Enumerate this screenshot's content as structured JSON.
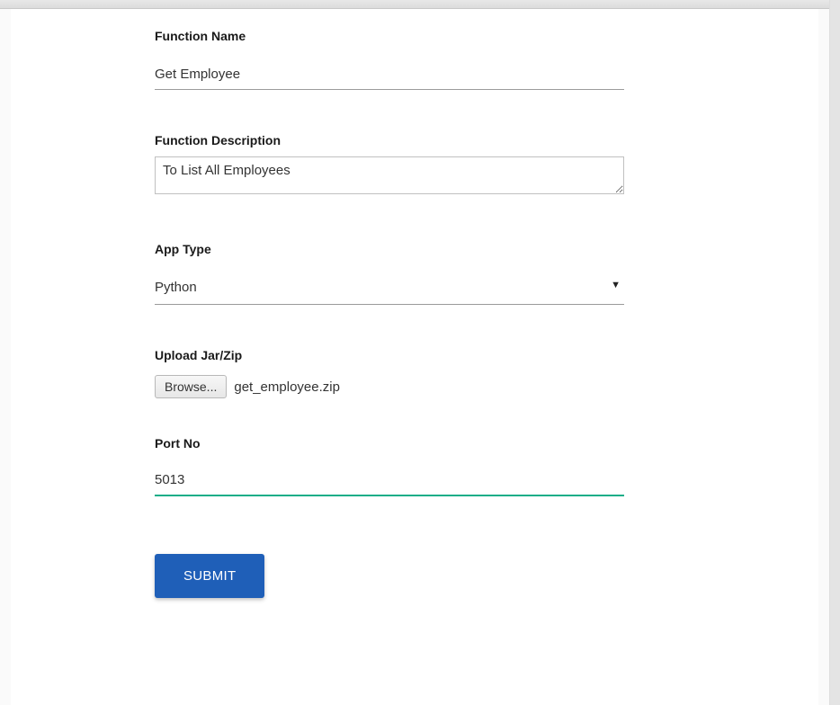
{
  "form": {
    "function_name": {
      "label": "Function Name",
      "value": "Get Employee"
    },
    "function_description": {
      "label": "Function Description",
      "value": "To List All Employees"
    },
    "app_type": {
      "label": "App Type",
      "value": "Python"
    },
    "upload": {
      "label": "Upload Jar/Zip",
      "browse_label": "Browse...",
      "file_name": "get_employee.zip"
    },
    "port_no": {
      "label": "Port No",
      "value": "5013"
    },
    "submit_label": "SUBMIT"
  }
}
